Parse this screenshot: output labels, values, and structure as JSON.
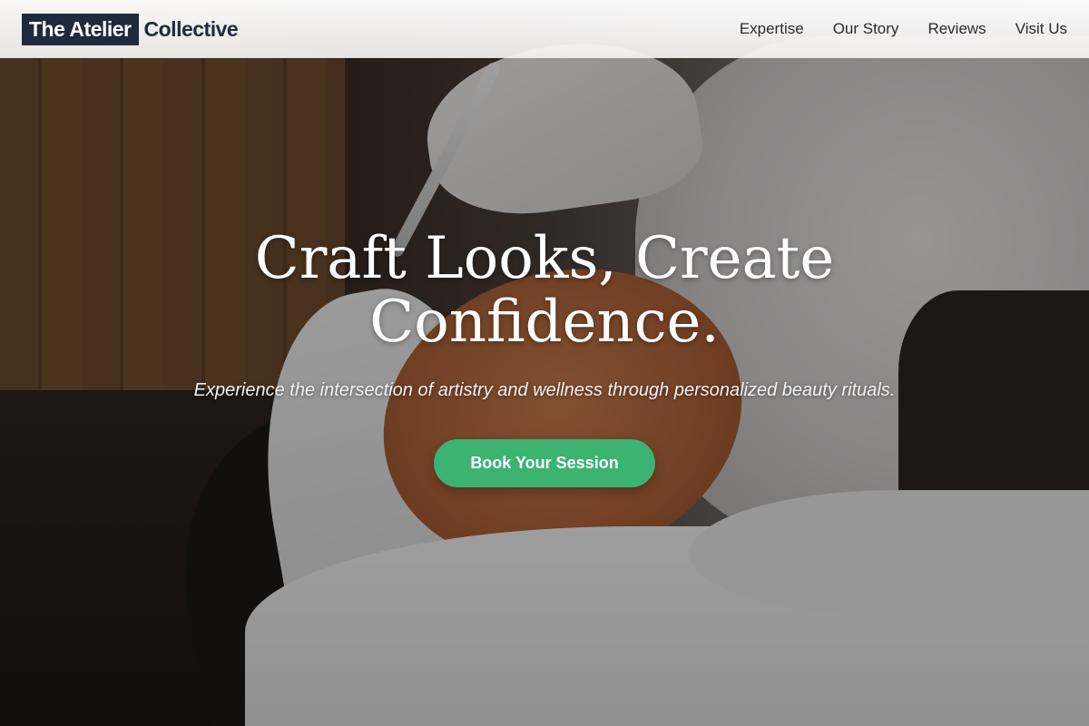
{
  "brand": {
    "boxed": "The Atelier",
    "rest": "Collective",
    "colors": {
      "navy": "#1f2a3c",
      "accent_green": "#3cb371"
    }
  },
  "nav": {
    "items": [
      {
        "label": "Expertise"
      },
      {
        "label": "Our Story"
      },
      {
        "label": "Reviews"
      },
      {
        "label": "Visit Us"
      }
    ]
  },
  "hero": {
    "headline": "Craft Looks, Create Confidence.",
    "subhead": "Experience the intersection of artistry and wellness through personalized beauty rituals.",
    "cta_label": "Book Your Session",
    "background": "photo of woman receiving facial mask application"
  }
}
